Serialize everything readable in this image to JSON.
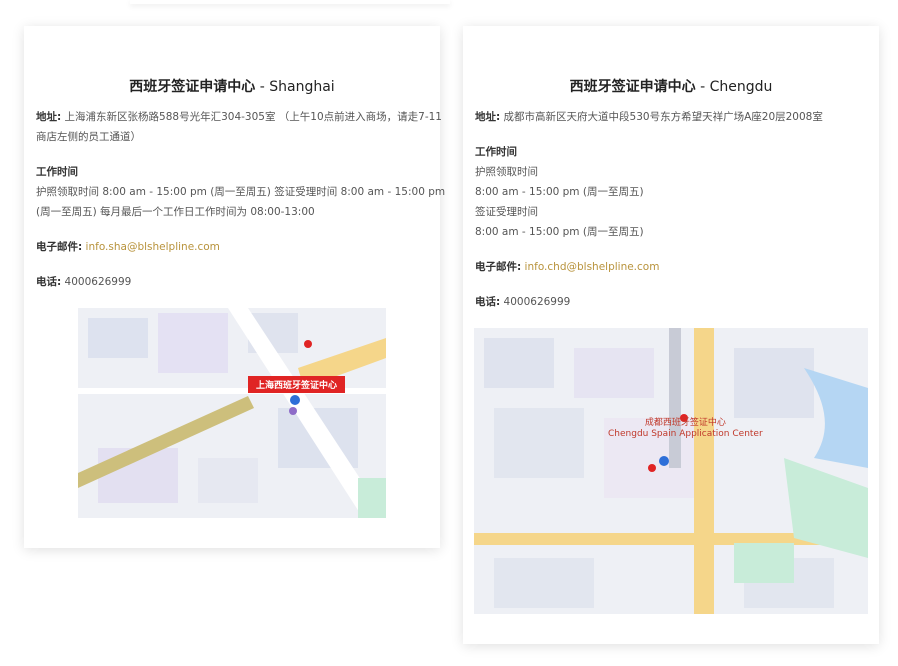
{
  "shanghai": {
    "title_cn": "西班牙签证申请中心",
    "title_city": " - Shanghai",
    "address_label": "地址:",
    "address_line1": " 上海浦东新区张杨路588号光年汇304-305室 （上午10点前进入商场，请走7-11",
    "address_line2": "商店左侧的员工通道）",
    "hours_label": "工作时间",
    "hours_line1": "护照领取时间 8:00 am - 15:00 pm (周一至周五) 签证受理时间 8:00 am - 15:00 pm",
    "hours_line2": "(周一至周五) 每月最后一个工作日工作时间为 08:00-13:00",
    "email_label": "电子邮件:",
    "email": "info.sha@blshelpline.com",
    "phone_label": "电话:",
    "phone": " 4000626999",
    "map_marker_label": "上海西班牙签证中心"
  },
  "chengdu": {
    "title_cn": "西班牙签证申请中心",
    "title_city": " - Chengdu",
    "address_label": "地址:",
    "address": " 成都市高新区天府大道中段530号东方希望天祥广场A座20层2008室",
    "hours_label": "工作时间",
    "pickup_label": "护照领取时间",
    "pickup_hours": "8:00 am - 15:00 pm (周一至周五)",
    "accept_label": "签证受理时间",
    "accept_hours": "8:00 am - 15:00 pm (周一至周五)",
    "email_label": "电子邮件:",
    "email": "info.chd@blshelpline.com",
    "phone_label": "电话:",
    "phone": " 4000626999",
    "map_marker_cn": "成都西班牙签证中心",
    "map_marker_en": "Chengdu Spain Application Center"
  },
  "colors": {
    "link": "#b8933c",
    "map_marker_red": "#e02424",
    "map_road_yellow": "#f5d68a",
    "map_pin_blue": "#2e6fd8"
  }
}
